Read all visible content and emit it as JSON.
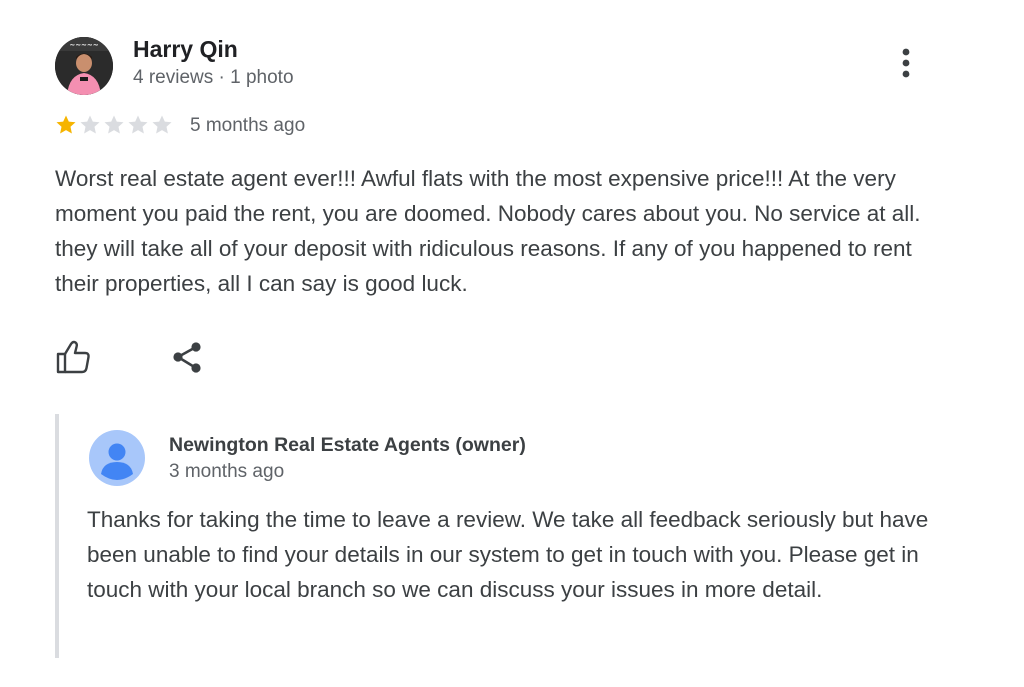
{
  "review": {
    "reviewer_name": "Harry Qin",
    "reviewer_meta": "4 reviews · 1 photo",
    "rating": 1,
    "rating_max": 5,
    "date": "5 months ago",
    "text": "Worst real estate agent ever!!! Awful flats with the most expensive price!!! At the very moment you paid the rent, you are doomed. Nobody cares about you. No service at all. they will take all of your deposit with ridiculous reasons. If any of you happened to rent their properties, all I can say is good luck.",
    "icons": {
      "more": "more-vert-icon",
      "like": "thumbs-up-icon",
      "share": "share-icon"
    }
  },
  "owner_response": {
    "name": "Newington Real Estate Agents (owner)",
    "date": "3 months ago",
    "text": "Thanks for taking the time to leave a review. We take all feedback seriously but have been unable to find your details in our system to get in touch with you. Please get in touch with your local branch so we can discuss your issues in more detail.",
    "avatar_icon": "default-person-icon"
  },
  "colors": {
    "star_filled": "#f6b400",
    "star_empty": "#dadce0",
    "owner_avatar_bg": "#a8c7fa",
    "owner_avatar_fg": "#4285f4",
    "secondary_text": "#5f6368",
    "divider": "#dadce0"
  }
}
